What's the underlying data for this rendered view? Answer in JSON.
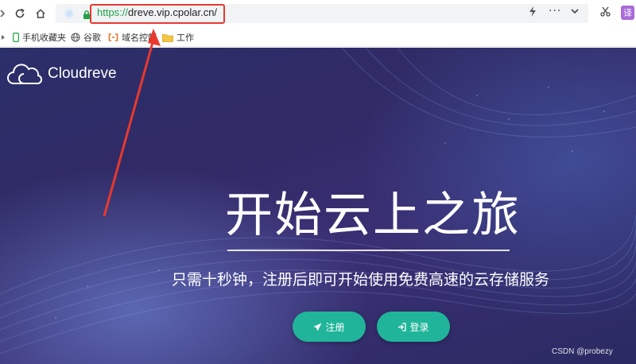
{
  "browser": {
    "url_scheme": "https://",
    "url_host": "dreve.vip.cpolar.cn/",
    "translate_label": "译"
  },
  "bookmarks": [
    {
      "label": "手机收藏夹",
      "icon": "phone-icon"
    },
    {
      "label": "谷歌",
      "icon": "globe-icon"
    },
    {
      "label": "域名控制",
      "icon": "bracket-icon"
    },
    {
      "label": "工作",
      "icon": "folder-icon"
    }
  ],
  "hero": {
    "logo_text": "Cloudreve",
    "headline": "开始云上之旅",
    "subline": "只需十秒钟，注册后即可开始使用免费高速的云存储服务",
    "register_label": "注册",
    "login_label": "登录",
    "watermark": "CSDN @probezy"
  },
  "colors": {
    "accent_button": "#20b59a",
    "annotation": "#e8382e",
    "url_scheme": "#1fa34a"
  }
}
